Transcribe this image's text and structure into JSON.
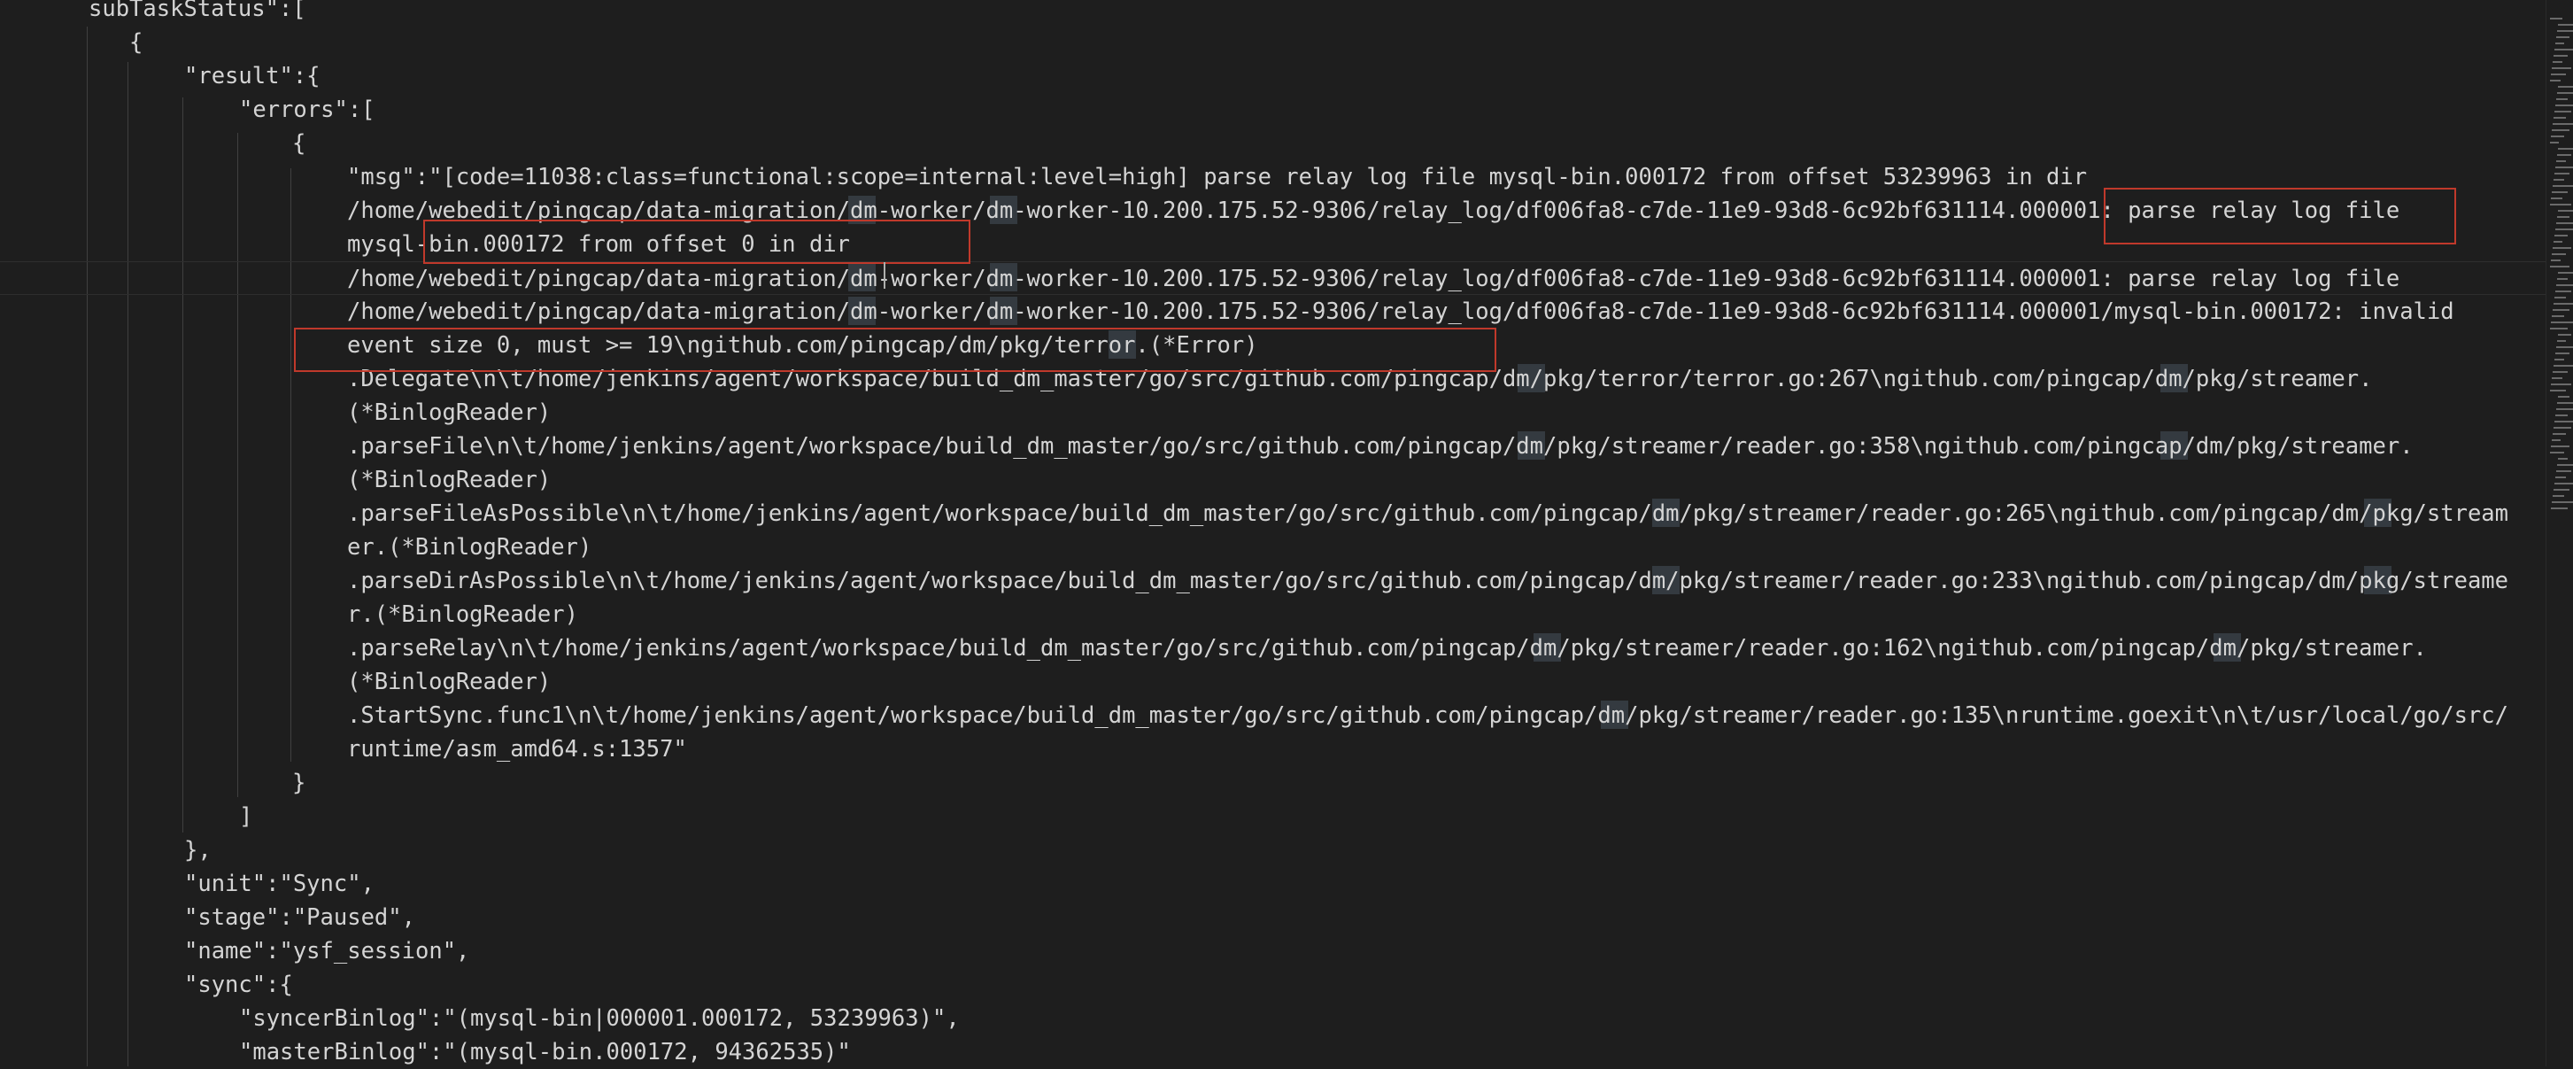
{
  "editor": {
    "lines": [
      "subTaskStatus\":[",
      "{",
      "\"result\":{",
      "\"errors\":[",
      "{",
      "\"msg\":\"[code=11038:class=functional:scope=internal:level=high] parse relay log file mysql-bin.000172 from offset 53239963 in dir",
      "/home/webedit/pingcap/data-migration/dm-worker/dm-worker-10.200.175.52-9306/relay_log/df006fa8-c7de-11e9-93d8-6c92bf631114.000001: parse relay log file",
      "mysql-bin.000172 from offset 0 in dir",
      "/home/webedit/pingcap/data-migration/dm-worker/dm-worker-10.200.175.52-9306/relay_log/df006fa8-c7de-11e9-93d8-6c92bf631114.000001: parse relay log file",
      "/home/webedit/pingcap/data-migration/dm-worker/dm-worker-10.200.175.52-9306/relay_log/df006fa8-c7de-11e9-93d8-6c92bf631114.000001/mysql-bin.000172: invalid",
      "event size 0, must >= 19\\ngithub.com/pingcap/dm/pkg/terror.(*Error)",
      ".Delegate\\n\\t/home/jenkins/agent/workspace/build_dm_master/go/src/github.com/pingcap/dm/pkg/terror/terror.go:267\\ngithub.com/pingcap/dm/pkg/streamer.",
      "(*BinlogReader)",
      ".parseFile\\n\\t/home/jenkins/agent/workspace/build_dm_master/go/src/github.com/pingcap/dm/pkg/streamer/reader.go:358\\ngithub.com/pingcap/dm/pkg/streamer.",
      "(*BinlogReader)",
      ".parseFileAsPossible\\n\\t/home/jenkins/agent/workspace/build_dm_master/go/src/github.com/pingcap/dm/pkg/streamer/reader.go:265\\ngithub.com/pingcap/dm/pkg/stream",
      "er.(*BinlogReader)",
      ".parseDirAsPossible\\n\\t/home/jenkins/agent/workspace/build_dm_master/go/src/github.com/pingcap/dm/pkg/streamer/reader.go:233\\ngithub.com/pingcap/dm/pkg/streame",
      "r.(*BinlogReader)",
      ".parseRelay\\n\\t/home/jenkins/agent/workspace/build_dm_master/go/src/github.com/pingcap/dm/pkg/streamer/reader.go:162\\ngithub.com/pingcap/dm/pkg/streamer.",
      "(*BinlogReader)",
      ".StartSync.func1\\n\\t/home/jenkins/agent/workspace/build_dm_master/go/src/github.com/pingcap/dm/pkg/streamer/reader.go:135\\nruntime.goexit\\n\\t/usr/local/go/src/",
      "runtime/asm_amd64.s:1357\"",
      "}",
      "]",
      "},",
      "\"unit\":\"Sync\",",
      "\"stage\":\"Paused\",",
      "\"name\":\"ysf_session\",",
      "\"sync\":{",
      "\"syncerBinlog\":\"(mysql-bin|000001.000172, 53239963)\",",
      "\"masterBinlog\":\"(mysql-bin.000172, 94362535)\""
    ]
  }
}
